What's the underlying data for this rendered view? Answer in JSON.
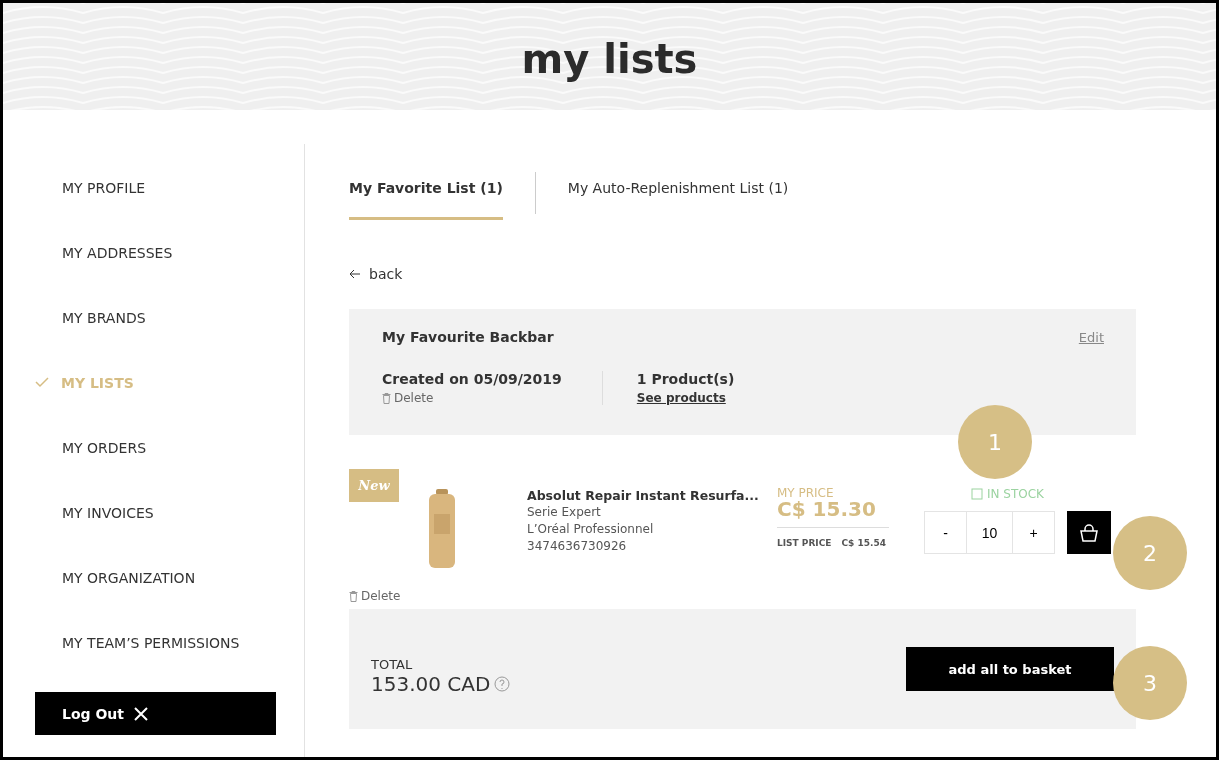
{
  "header": {
    "title": "my lists"
  },
  "sidebar": {
    "items": [
      {
        "label": "MY PROFILE",
        "selected": false
      },
      {
        "label": "MY ADDRESSES",
        "selected": false
      },
      {
        "label": "MY BRANDS",
        "selected": false
      },
      {
        "label": "MY LISTS",
        "selected": true
      },
      {
        "label": "MY ORDERS",
        "selected": false
      },
      {
        "label": "MY INVOICES",
        "selected": false
      },
      {
        "label": "MY ORGANIZATION",
        "selected": false
      },
      {
        "label": "MY TEAM’S PERMISSIONS",
        "selected": false
      }
    ],
    "logout": "Log Out"
  },
  "tabs": [
    {
      "label": "My Favorite List (1)",
      "selected": true
    },
    {
      "label": "My Auto-Replenishment List (1)",
      "selected": false
    }
  ],
  "back": "back",
  "list": {
    "name": "My Favourite Backbar",
    "edit": "Edit",
    "created": "Created on 05/09/2019",
    "delete": "Delete",
    "count": "1 Product(s)",
    "see": "See products"
  },
  "product": {
    "badge": "New",
    "name": "Absolut Repair Instant Resurfa...",
    "line": "Serie Expert",
    "brand": "L’Oréal Professionnel",
    "code": "3474636730926",
    "my_price_label": "MY PRICE",
    "my_price": "C$ 15.30",
    "list_price_label": "LIST PRICE",
    "list_price": "C$ 15.54",
    "stock": "IN STOCK",
    "minus": "-",
    "quantity": "10",
    "plus": "+",
    "delete": "Delete"
  },
  "total": {
    "label": "TOTAL",
    "amount": "153.00 CAD",
    "button": "add all to basket"
  },
  "callouts": [
    "1",
    "2",
    "3"
  ]
}
